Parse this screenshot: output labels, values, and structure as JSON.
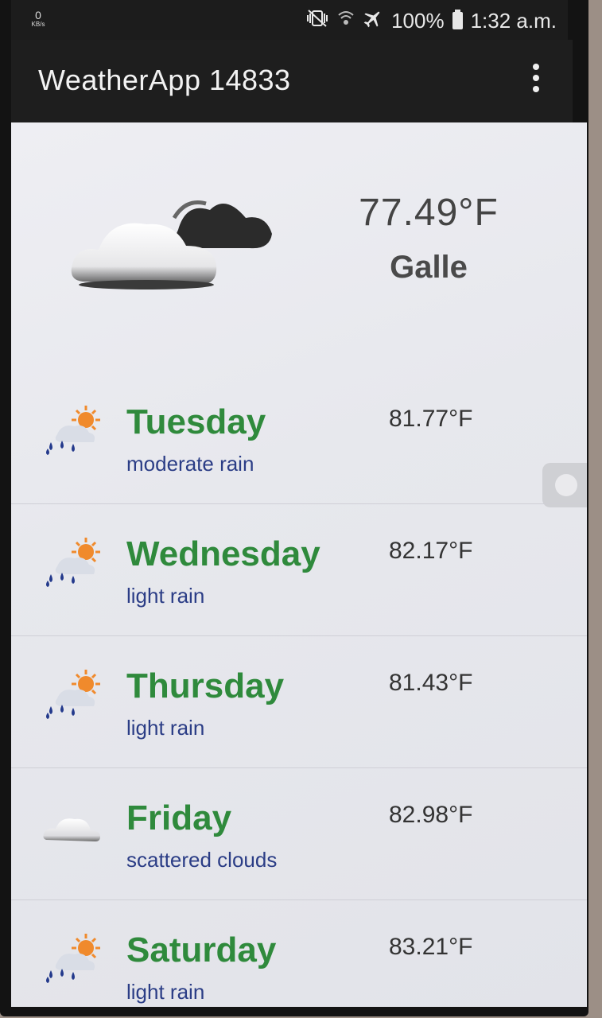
{
  "status_bar": {
    "net_speed_value": "0",
    "net_speed_unit": "KB/s",
    "battery": "100%",
    "time": "1:32 a.m."
  },
  "app_bar": {
    "title": "WeatherApp 14833"
  },
  "current": {
    "temperature": "77.49°F",
    "city": "Galle",
    "icon": "cloud-sun-icon"
  },
  "forecast": [
    {
      "day": "Tuesday",
      "description": "moderate rain",
      "temperature": "81.77°F",
      "icon": "rain-sun-icon"
    },
    {
      "day": "Wednesday",
      "description": "light rain",
      "temperature": "82.17°F",
      "icon": "rain-sun-icon"
    },
    {
      "day": "Thursday",
      "description": "light rain",
      "temperature": "81.43°F",
      "icon": "rain-sun-icon"
    },
    {
      "day": "Friday",
      "description": "scattered clouds",
      "temperature": "82.98°F",
      "icon": "cloud-icon"
    },
    {
      "day": "Saturday",
      "description": "light rain",
      "temperature": "83.21°F",
      "icon": "rain-sun-icon"
    }
  ],
  "colors": {
    "day_green": "#2f8a3c",
    "desc_blue": "#2b3d86",
    "appbar": "#1e1e1e"
  }
}
